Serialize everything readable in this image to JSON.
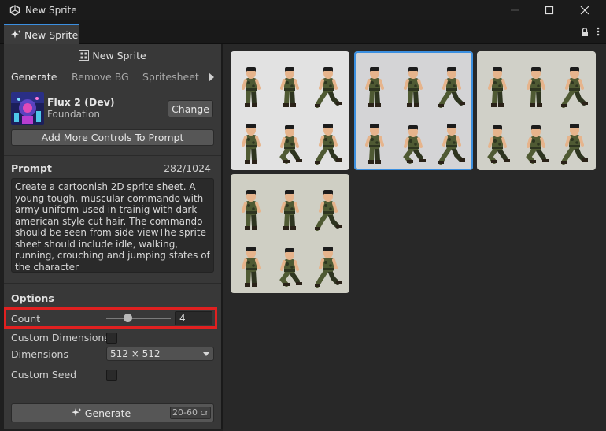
{
  "window": {
    "title": "New Sprite"
  },
  "tab": {
    "label": "New Sprite"
  },
  "panel": {
    "header": "New Sprite",
    "subtabs": [
      "Generate",
      "Remove BG",
      "Spritesheet"
    ],
    "model": {
      "name": "Flux 2 (Dev)",
      "subtitle": "Foundation",
      "change_label": "Change"
    },
    "add_controls_label": "Add More Controls To Prompt",
    "prompt": {
      "label": "Prompt",
      "count": "282/1024",
      "text": "Create a cartoonish 2D sprite sheet. A young tough, muscular commando with army uniform used in trainig with dark american style cut hair. The commando should be seen from side viewThe sprite sheet should include idle, walking, running, crouching and jumping states of the character"
    },
    "options": {
      "label": "Options",
      "count_label": "Count",
      "count_value": "4",
      "count_slider_fraction": 0.33,
      "custom_dimensions_label": "Custom Dimensions",
      "dimensions_label": "Dimensions",
      "dimensions_value": "512 × 512",
      "custom_seed_label": "Custom Seed"
    },
    "generate": {
      "label": "Generate",
      "cost": "20-60 cr"
    }
  },
  "gallery": {
    "images": [
      {
        "background": "#e2e2e2",
        "selected": false
      },
      {
        "background": "#d4d4d6",
        "selected": true
      },
      {
        "background": "#d0d0c8",
        "selected": false
      },
      {
        "background": "#cfcfc4",
        "selected": false
      }
    ]
  },
  "colors": {
    "accent": "#3b8fe0",
    "highlight": "#e02020",
    "uniform": "#4f5a33"
  }
}
